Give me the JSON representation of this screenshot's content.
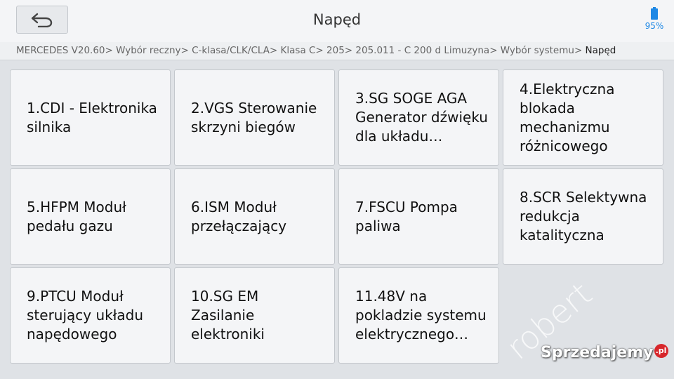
{
  "header": {
    "title": "Napęd",
    "battery": "95%"
  },
  "breadcrumb": {
    "path": "MERCEDES V20.60> Wybór reczny> C-klasa/CLK/CLA> Klasa C> 205> 205.011 - C 200 d Limuzyna> Wybór systemu>",
    "current": " Napęd"
  },
  "systems": [
    {
      "label": "1.CDI - Elektronika silnika"
    },
    {
      "label": "2.VGS Sterowanie skrzyni biegów"
    },
    {
      "label": "3.SG SOGE AGA Generator dźwięku dla układu…"
    },
    {
      "label": "4.Elektryczna blokada mechanizmu różnicowego"
    },
    {
      "label": "5.HFPM Moduł pedału gazu"
    },
    {
      "label": "6.ISM Moduł przełączający"
    },
    {
      "label": "7.FSCU Pompa paliwa"
    },
    {
      "label": "8.SCR Selektywna redukcja katalityczna"
    },
    {
      "label": "9.PTCU Moduł sterujący układu napędowego"
    },
    {
      "label": "10.SG EM Zasilanie elektroniki"
    },
    {
      "label": "11.48V na pokladzie systemu elektrycznego…"
    }
  ],
  "watermark": {
    "text": "robert",
    "logo_text": "Sprzedajemy",
    "logo_suffix": ".pl"
  },
  "colors": {
    "accent": "#1e88e5",
    "background": "#dfe2e6",
    "tile": "#f4f5f7"
  },
  "icons": {
    "back": "back-arrow-icon",
    "battery": "battery-icon"
  }
}
